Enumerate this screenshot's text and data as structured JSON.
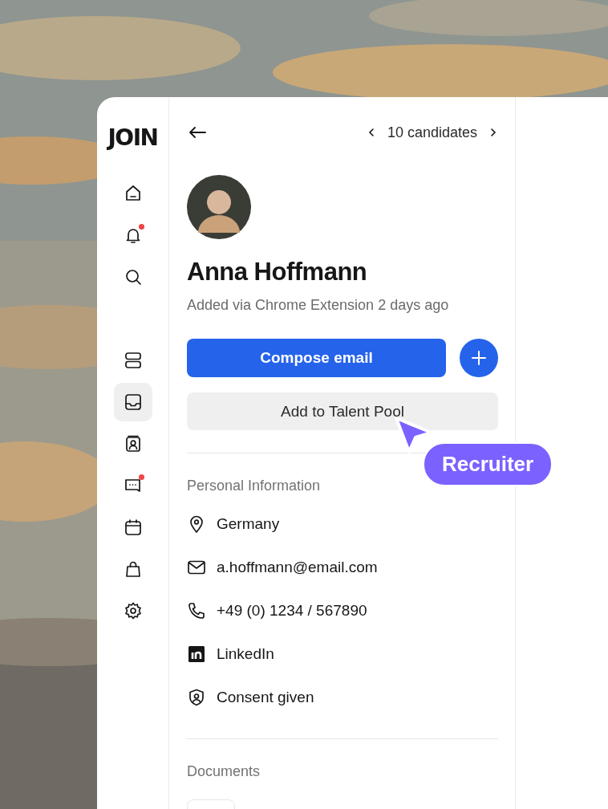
{
  "sidebar": {
    "logo": "JOIN",
    "nav_top": [
      {
        "kind": "home",
        "selected": false,
        "badge": false
      },
      {
        "kind": "bell",
        "selected": false,
        "badge": true
      },
      {
        "kind": "search",
        "selected": false,
        "badge": false
      }
    ],
    "nav_main": [
      {
        "kind": "rows",
        "selected": false,
        "badge": false
      },
      {
        "kind": "inbox",
        "selected": true,
        "badge": false
      },
      {
        "kind": "contact",
        "selected": false,
        "badge": false
      },
      {
        "kind": "chat",
        "selected": false,
        "badge": true
      },
      {
        "kind": "calendar",
        "selected": false,
        "badge": false
      },
      {
        "kind": "bag",
        "selected": false,
        "badge": false
      },
      {
        "kind": "settings",
        "selected": false,
        "badge": false
      }
    ]
  },
  "header": {
    "pager": "10 candidates"
  },
  "candidate": {
    "name": "Anna Hoffmann",
    "source": "Added via Chrome Extension 2 days ago"
  },
  "actions": {
    "primary": "Compose email",
    "secondary": "Add to Talent Pool"
  },
  "cursor": {
    "label": "Recruiter"
  },
  "personal_information": {
    "title": "Personal Information",
    "items": [
      {
        "kind": "location",
        "text": "Germany"
      },
      {
        "kind": "email",
        "text": "a.hoffmann@email.com"
      },
      {
        "kind": "phone",
        "text": "+49 (0) 1234 / 567890"
      },
      {
        "kind": "linkedin",
        "text": "LinkedIn"
      },
      {
        "kind": "consent",
        "text": "Consent given"
      }
    ]
  },
  "documents": {
    "title": "Documents"
  }
}
